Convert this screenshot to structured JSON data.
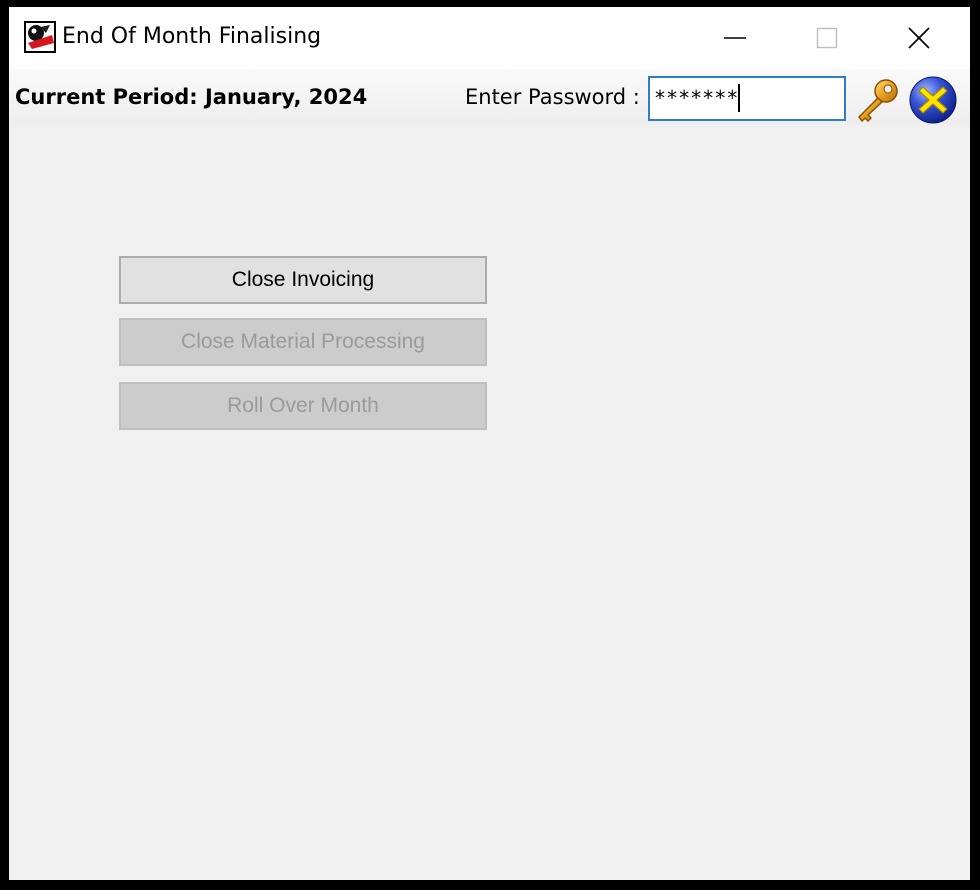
{
  "window": {
    "title": "End Of Month Finalising"
  },
  "toolbar": {
    "current_period": "Current Period: January, 2024",
    "password_label": "Enter Password :",
    "password_value": "*******"
  },
  "actions": {
    "close_invoicing": "Close Invoicing",
    "close_material_processing": "Close Material Processing",
    "roll_over_month": "Roll Over Month"
  },
  "states": {
    "close_invoicing_enabled": true,
    "close_material_processing_enabled": false,
    "roll_over_month_enabled": false
  },
  "icons": {
    "app": "app-logo-icon",
    "login": "key-icon",
    "cancel": "cancel-x-icon"
  },
  "colors": {
    "input_focus_border": "#2f7bcc",
    "key_gold": "#e8a020",
    "cancel_blue": "#1c35b8",
    "cancel_yellow": "#ffe400"
  }
}
